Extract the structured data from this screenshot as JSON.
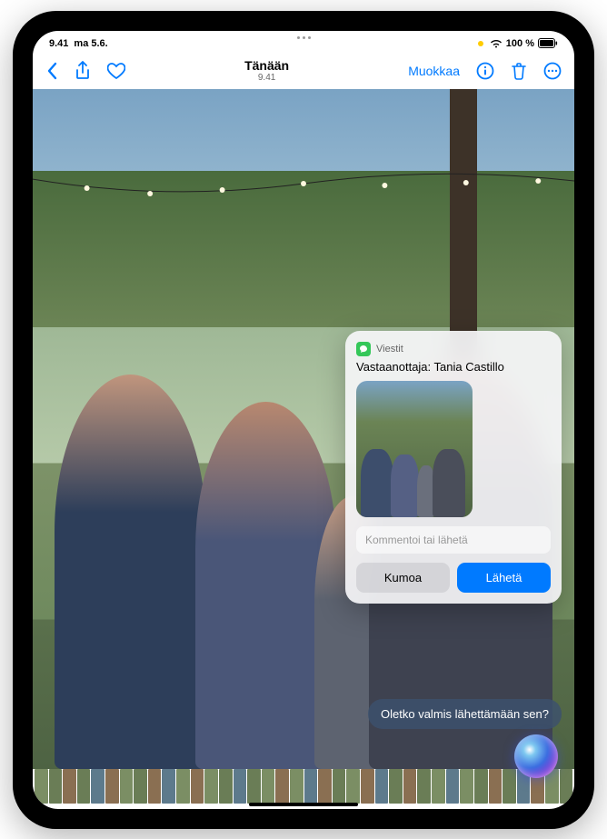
{
  "status": {
    "time": "9.41",
    "date": "ma 5.6.",
    "battery_percent": "100 %"
  },
  "nav": {
    "title": "Tänään",
    "subtitle": "9.41",
    "edit_label": "Muokkaa"
  },
  "siri_card": {
    "app_name": "Viestit",
    "recipient_line": "Vastaanottaja: Tania Castillo",
    "comment_placeholder": "Kommentoi tai lähetä",
    "cancel_label": "Kumoa",
    "send_label": "Lähetä"
  },
  "siri_query": "Oletko valmis lähettämään sen?",
  "filmstrip_count": 38
}
